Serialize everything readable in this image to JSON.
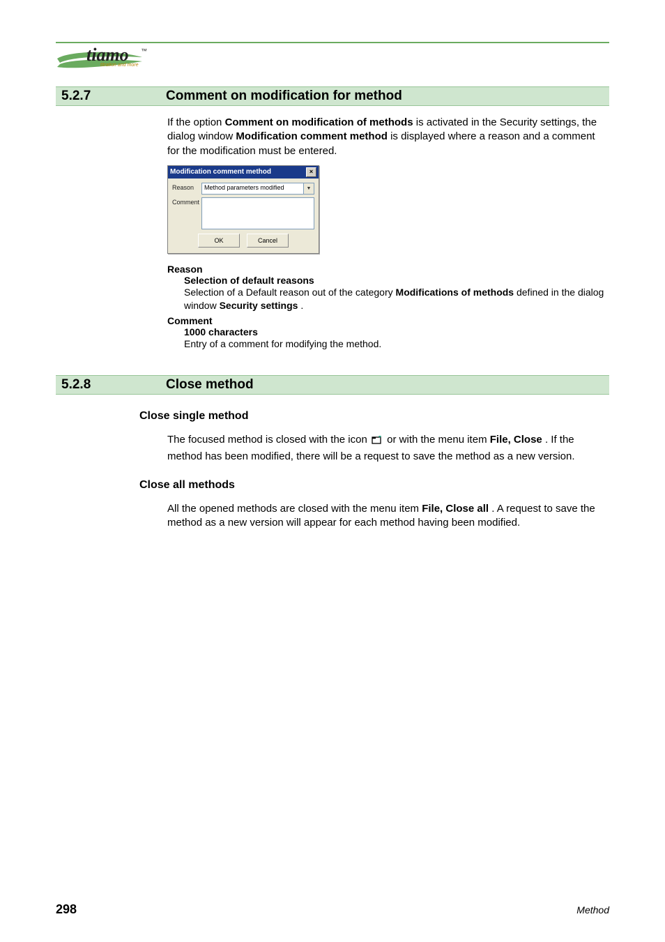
{
  "logo": {
    "brand": "tiamo",
    "tm": "™",
    "tagline": "titration and more"
  },
  "section_527": {
    "number": "5.2.7",
    "title": "Comment on modification for method",
    "intro_pre": "If the option ",
    "intro_b1": "Comment on modification of methods",
    "intro_mid": " is activated in the Security settings, the dialog window ",
    "intro_b2": "Modification comment method",
    "intro_post": " is displayed where a reason and a comment for the modification must be entered.",
    "dialog": {
      "title": "Modification comment method",
      "reason_label": "Reason",
      "reason_value": "Method parameters modified",
      "comment_label": "Comment",
      "ok": "OK",
      "cancel": "Cancel"
    },
    "defs": {
      "reason_term": "Reason",
      "reason_sub_b": "Selection of default reasons",
      "reason_sub_t_pre": "Selection of a Default reason out of the category ",
      "reason_sub_t_b1": "Modifications of methods",
      "reason_sub_t_mid": " defined in the dialog window ",
      "reason_sub_t_b2": "Security settings",
      "reason_sub_t_post": ".",
      "comment_term": "Comment",
      "comment_sub_b": "1000 characters",
      "comment_sub_t": "Entry of a comment for modifying the method."
    }
  },
  "section_528": {
    "number": "5.2.8",
    "title": "Close method",
    "close_single": {
      "heading": "Close single method",
      "t_pre": "The focused method is closed with the icon ",
      "t_mid": " or with the menu item ",
      "t_b1": "File, Close",
      "t_post": ". If the method has been modified, there will be a request to save the method as a new version."
    },
    "close_all": {
      "heading": "Close all methods",
      "t_pre": "All the opened methods are closed with the menu item ",
      "t_b1": "File, Close all",
      "t_post": ". A request to save the method as a new version will appear for each method having been modified."
    }
  },
  "footer": {
    "page": "298",
    "category": "Method"
  }
}
